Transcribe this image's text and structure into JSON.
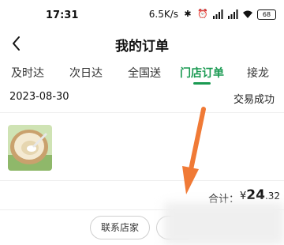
{
  "status_bar": {
    "time": "17:31",
    "net_speed": "6.5K/s",
    "icons": [
      "bluetooth-icon",
      "alarm-icon",
      "hd-signal-icon",
      "hd-signal-icon",
      "wifi-icon"
    ],
    "battery": "68"
  },
  "nav": {
    "title": "我的订单",
    "back_icon": "back-arrow-icon"
  },
  "tabs": [
    {
      "label": "及时达",
      "active": false
    },
    {
      "label": "次日达",
      "active": false
    },
    {
      "label": "全国送",
      "active": false
    },
    {
      "label": "门店订单",
      "active": true
    },
    {
      "label": "接龙",
      "active": false
    }
  ],
  "order": {
    "date": "2023-08-30",
    "status": "交易成功",
    "total_label": "合计：",
    "currency": "¥",
    "total_int": "24",
    "total_dec": ".32",
    "buttons": {
      "contact_store": "联系店家"
    }
  },
  "colors": {
    "accent": "#1a9a52",
    "annotation_arrow": "#f07a36"
  }
}
